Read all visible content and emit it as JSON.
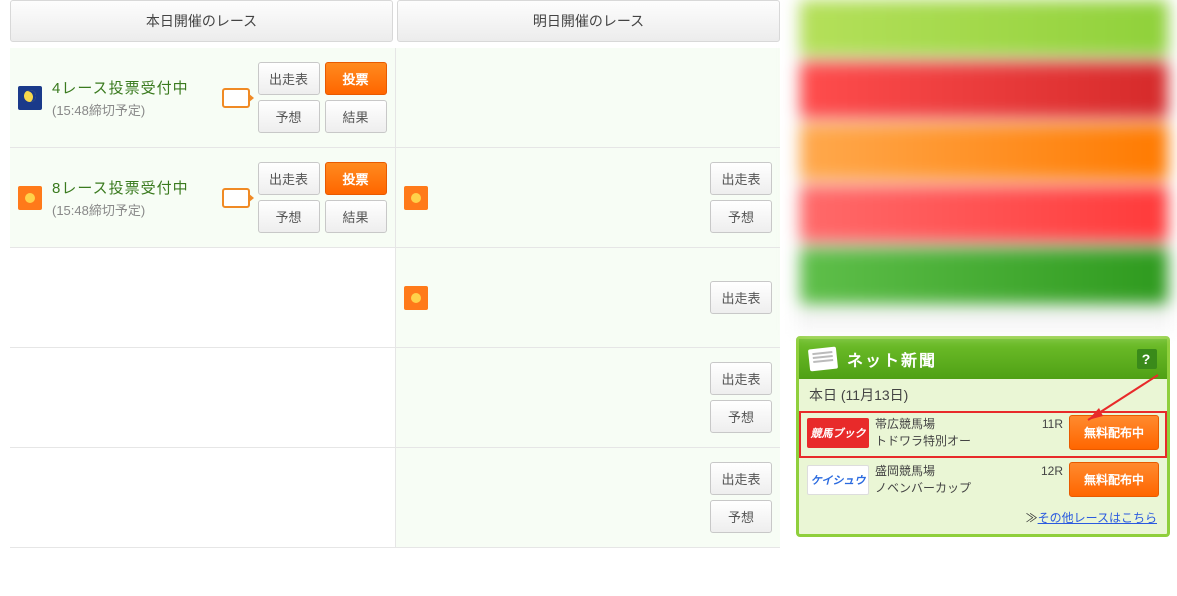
{
  "tabs": {
    "today": "本日開催のレース",
    "tomorrow": "明日開催のレース"
  },
  "btn": {
    "entry": "出走表",
    "vote": "投票",
    "predict": "予想",
    "result": "結果"
  },
  "today_rows": [
    {
      "icon": "moon",
      "title": "4レース投票受付中",
      "sub": "(15:48締切予定)",
      "camera": true,
      "buttons": [
        "entry",
        "vote",
        "predict",
        "result"
      ]
    },
    {
      "icon": "sun",
      "title": "8レース投票受付中",
      "sub": "(15:48締切予定)",
      "camera": true,
      "buttons": [
        "entry",
        "vote",
        "predict",
        "result"
      ]
    }
  ],
  "tomorrow_rows": [
    {
      "empty": true
    },
    {
      "icon": "sun",
      "buttons": [
        "entry",
        "predict"
      ]
    },
    {
      "icon": "sun",
      "buttons": [
        "entry"
      ]
    },
    {
      "buttons": [
        "entry",
        "predict"
      ]
    },
    {
      "buttons": [
        "entry",
        "predict"
      ]
    }
  ],
  "news": {
    "header": "ネット新聞",
    "help": "?",
    "date": "本日 (11月13日)",
    "items": [
      {
        "logo_style": "red",
        "logo": "競馬ブック",
        "track": "帯広競馬場",
        "race": "11R",
        "name": "トドワラ特別オー",
        "btn": "無料配布中",
        "highlight": true
      },
      {
        "logo_style": "blue",
        "logo": "ケイシュウ",
        "track": "盛岡競馬場",
        "race": "12R",
        "name": "ノベンバーカップ",
        "btn": "無料配布中",
        "highlight": false
      }
    ],
    "more_prefix": "≫",
    "more": "その他レースはこちら"
  }
}
